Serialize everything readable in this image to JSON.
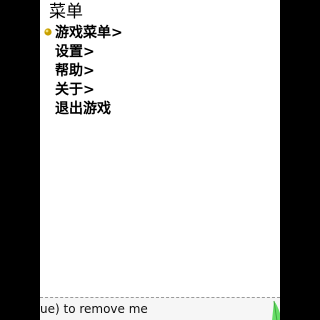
{
  "menu": {
    "title": "菜单",
    "items": [
      {
        "label": "游戏菜单",
        "arrow": ">",
        "selected": true
      },
      {
        "label": "设置",
        "arrow": ">",
        "selected": false
      },
      {
        "label": "帮助",
        "arrow": ">",
        "selected": false
      },
      {
        "label": "关于",
        "arrow": ">",
        "selected": false
      },
      {
        "label": "退出游戏",
        "arrow": "",
        "selected": false
      }
    ],
    "cursor_icon": "bullet-ball-icon"
  },
  "status_bar": {
    "text": "ue) to remove me",
    "decoration_icon": "green-leaf-icon"
  },
  "colors": {
    "screen_bg": "#ffffff",
    "outer_bg": "#000000",
    "text": "#000000",
    "cursor": "#c8a000",
    "leaf": "#66dd66"
  }
}
